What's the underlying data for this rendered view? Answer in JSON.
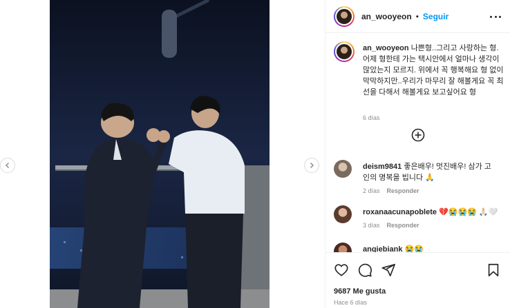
{
  "post": {
    "author": {
      "username": "an_wooyeon",
      "follow_label": "Seguir",
      "separator": "•"
    },
    "caption": {
      "username": "an_wooyeon",
      "text": "나쁜형..그리고 사랑하는 형. 어제 형한테 가는 택시안에서 얼마나 생각이 많았는지 모르지. 위에서 꼭 행복해요 형 없이 막막하지만..우리가 마무리 잘 해볼게요 꼭 최선을 다해서 해볼게요 보고싶어요 형",
      "time": "6 días"
    },
    "comments": [
      {
        "username": "deism9841",
        "text": "좋은배우! 멋진배우! 삼가 고인의 명복을 빕니다 🙏",
        "time": "2 días",
        "reply_label": "Responder"
      },
      {
        "username": "roxanaacunapoblete",
        "text": "💔😭😭😭 🙏🏻🤍",
        "time": "3 días",
        "reply_label": "Responder"
      },
      {
        "username": "angiebiank",
        "text": "😭😭"
      }
    ],
    "likes": "9687 Me gusta",
    "posted": "Hace 6 días"
  },
  "icons": {
    "more": "more-options-icon",
    "load_more": "plus-circle-icon",
    "like": "heart-icon",
    "comment": "comment-icon",
    "share": "share-icon",
    "save": "bookmark-icon",
    "prev": "chevron-left-icon",
    "next": "chevron-right-icon"
  },
  "colors": {
    "link": "#0095f6",
    "text": "#262626",
    "muted": "#8e8e8e"
  }
}
